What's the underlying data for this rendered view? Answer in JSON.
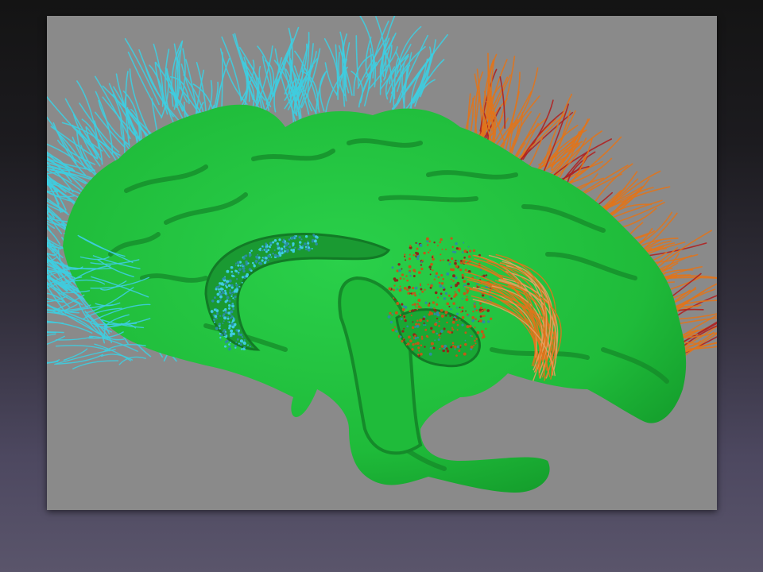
{
  "slide": {
    "background_top": "#141414",
    "background_bottom": "#5a556b"
  },
  "figure": {
    "viewport_background": "#8a8a8a",
    "brain_color": "#1fc03a",
    "brain_shadow_color": "#158a2a",
    "fiber_colors": [
      "#3ecde0",
      "#e0741c",
      "#b02020"
    ]
  }
}
